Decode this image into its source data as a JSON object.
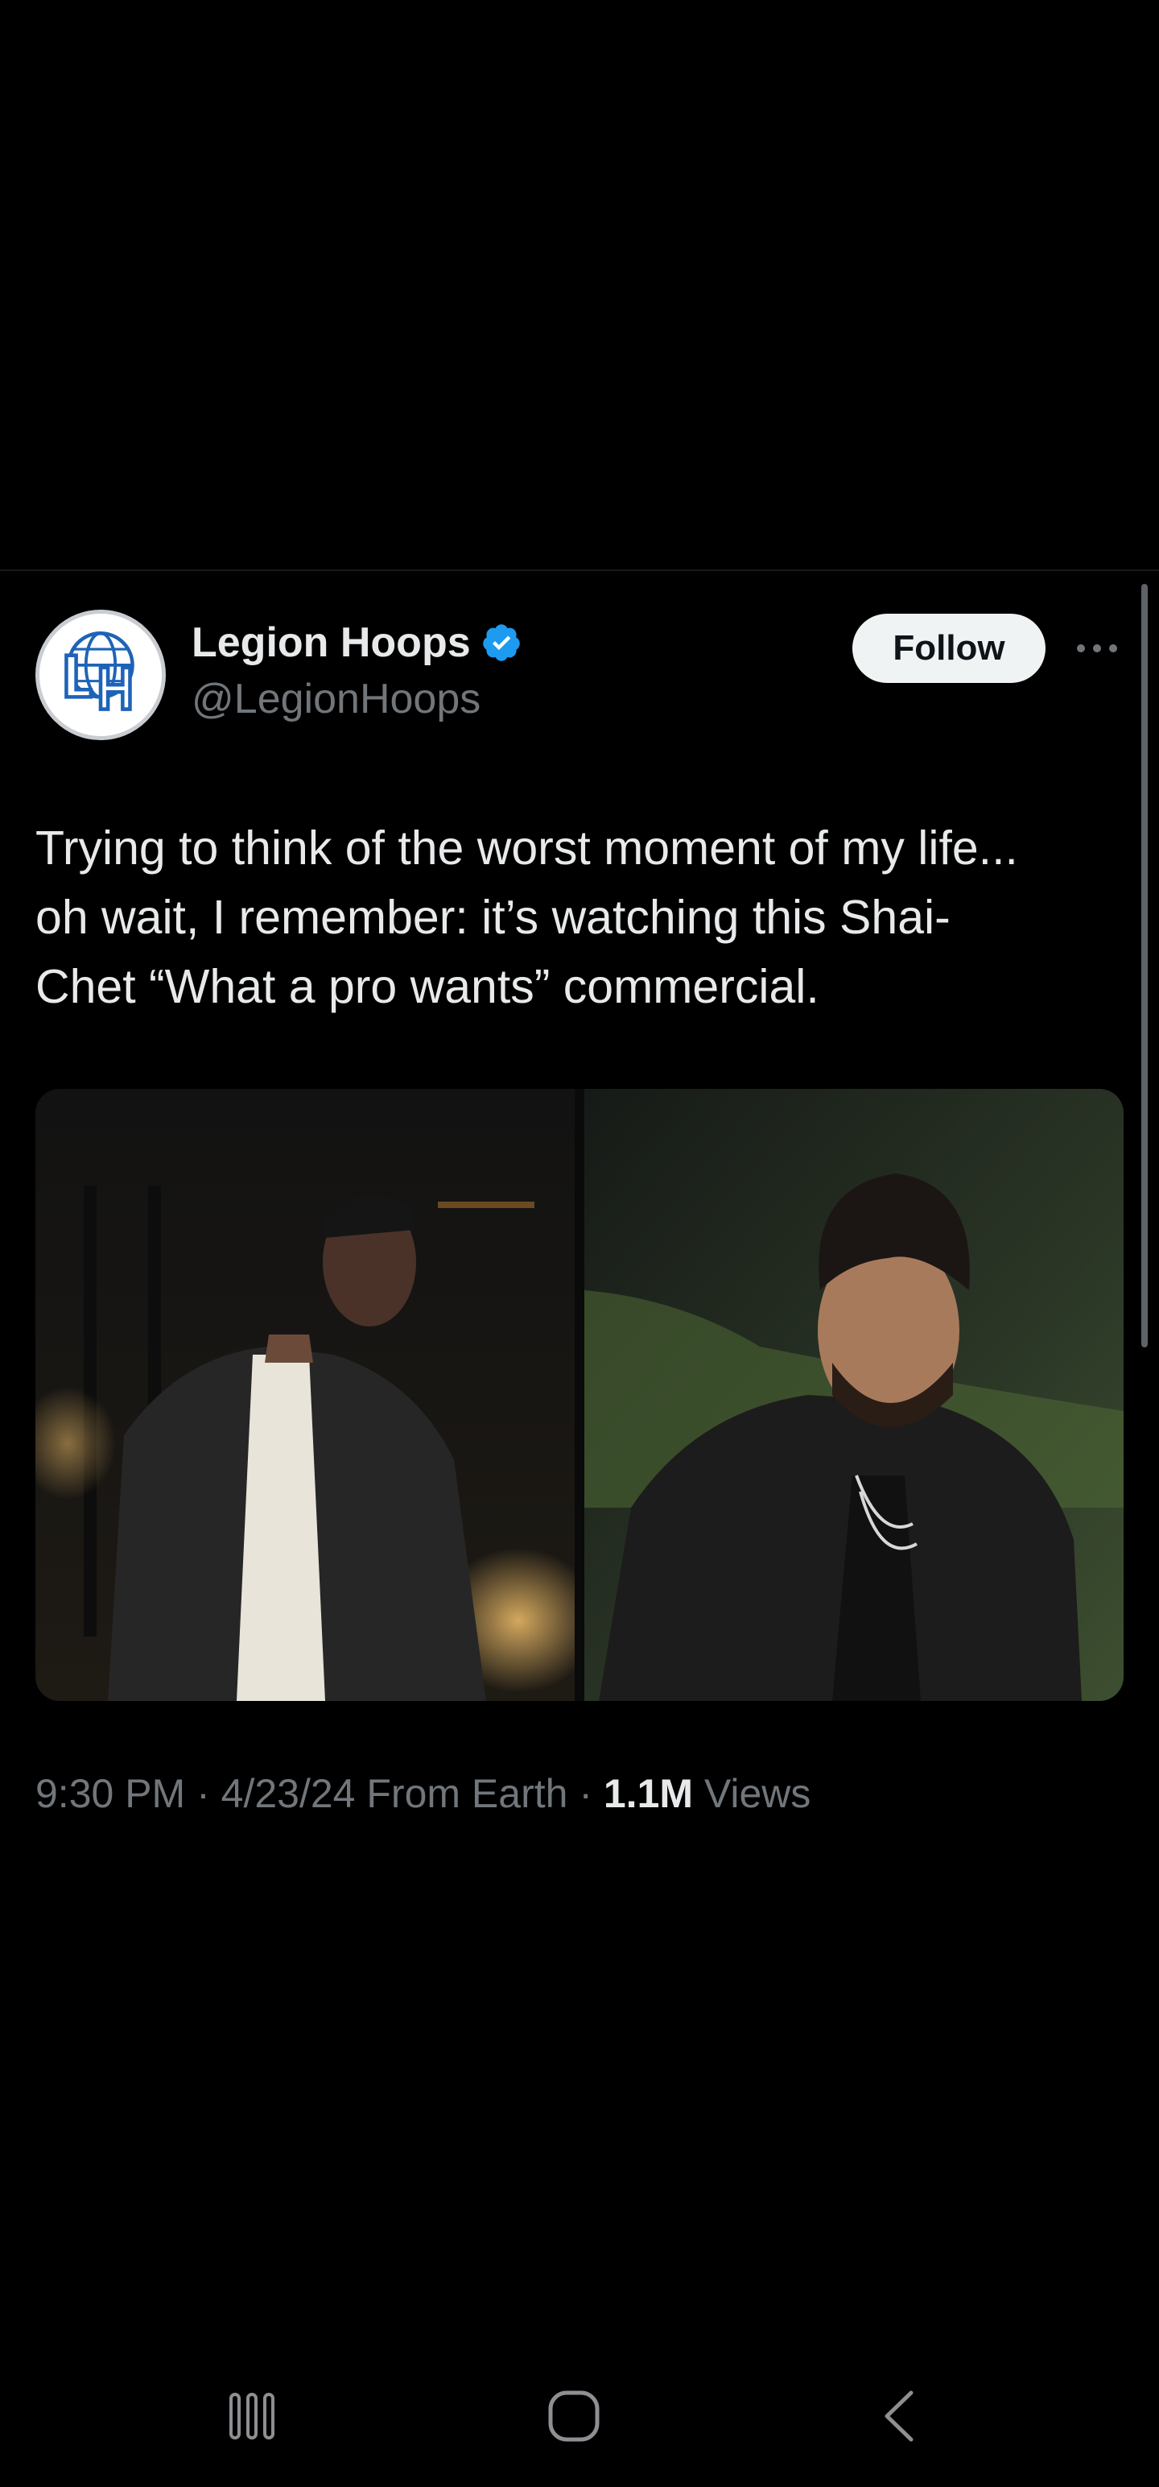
{
  "tweet": {
    "author": {
      "display_name": "Legion Hoops",
      "handle": "@LegionHoops",
      "verified": true,
      "avatar_letters": "LH"
    },
    "follow_label": "Follow",
    "text_lines": [
      "Trying to think of the worst moment of my life...",
      "oh wait, I remember: it’s watching this Shai-",
      "Chet “What a pro wants” commercial."
    ],
    "meta": {
      "time": "9:30 PM",
      "separator": " · ",
      "date": "4/23/24",
      "source": " From Earth",
      "views_count": "1.1M",
      "views_label": " Views"
    }
  },
  "icons": {
    "verified": "verified-badge-icon",
    "more": "more-options-icon",
    "nav_recents": "recent-apps-icon",
    "nav_home": "home-icon",
    "nav_back": "back-icon"
  },
  "colors": {
    "background": "#000000",
    "text_primary": "#e7e9ea",
    "text_secondary": "#71767b",
    "verified_blue": "#1d9bf0",
    "follow_bg": "#eff3f4"
  }
}
